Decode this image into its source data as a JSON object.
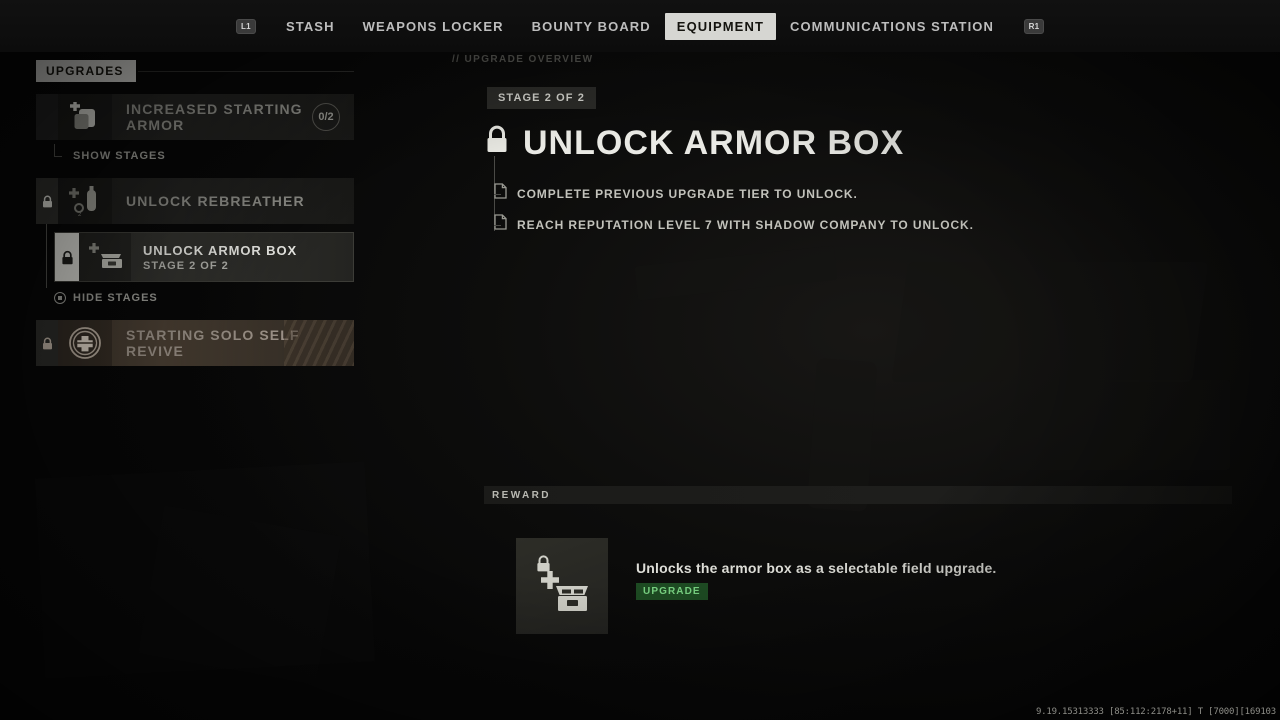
{
  "nav": {
    "left_bumper": "L1",
    "right_bumper": "R1",
    "items": [
      {
        "label": "STASH",
        "active": false
      },
      {
        "label": "WEAPONS LOCKER",
        "active": false
      },
      {
        "label": "BOUNTY BOARD",
        "active": false
      },
      {
        "label": "EQUIPMENT",
        "active": true
      },
      {
        "label": "COMMUNICATIONS STATION",
        "active": false
      }
    ]
  },
  "sidebar": {
    "header": "UPGRADES",
    "items": [
      {
        "label": "INCREASED STARTING ARMOR",
        "count": "0/2",
        "locked": false,
        "icon": "armor-plate-icon"
      },
      {
        "label": "UNLOCK REBREATHER",
        "locked": true,
        "icon": "rebreather-tank-icon"
      },
      {
        "label": "STARTING SOLO SELF REVIVE",
        "locked": true,
        "icon": "self-revive-icon"
      }
    ],
    "show_stages_label": "SHOW STAGES",
    "hide_stages_label": "HIDE STAGES",
    "stage": {
      "title": "UNLOCK ARMOR BOX",
      "subtitle": "STAGE 2 OF 2",
      "icon": "armor-box-icon",
      "locked": true
    }
  },
  "main": {
    "overview_label": "// UPGRADE OVERVIEW",
    "stage_badge": "STAGE 2 OF 2",
    "title": "UNLOCK ARMOR BOX",
    "title_icon": "lock-icon",
    "requirements": [
      "COMPLETE PREVIOUS UPGRADE TIER TO UNLOCK.",
      "REACH REPUTATION LEVEL 7 WITH SHADOW COMPANY TO UNLOCK."
    ],
    "reward": {
      "section_label": "REWARD",
      "description": "Unlocks the armor box as a selectable field upgrade.",
      "tag": "UPGRADE",
      "tag_color": "#1d4a22",
      "icon": "armor-box-reward-icon"
    }
  },
  "debug_text": "9.19.15313333 [85:112:2178+11] T [7000][169103",
  "colors": {
    "accent_light": "#d6d6d2",
    "text_primary": "#e9e9e4",
    "text_muted": "#8e8e88",
    "tag_green_bg": "#1d4a22",
    "tag_green_text": "#77d080"
  }
}
